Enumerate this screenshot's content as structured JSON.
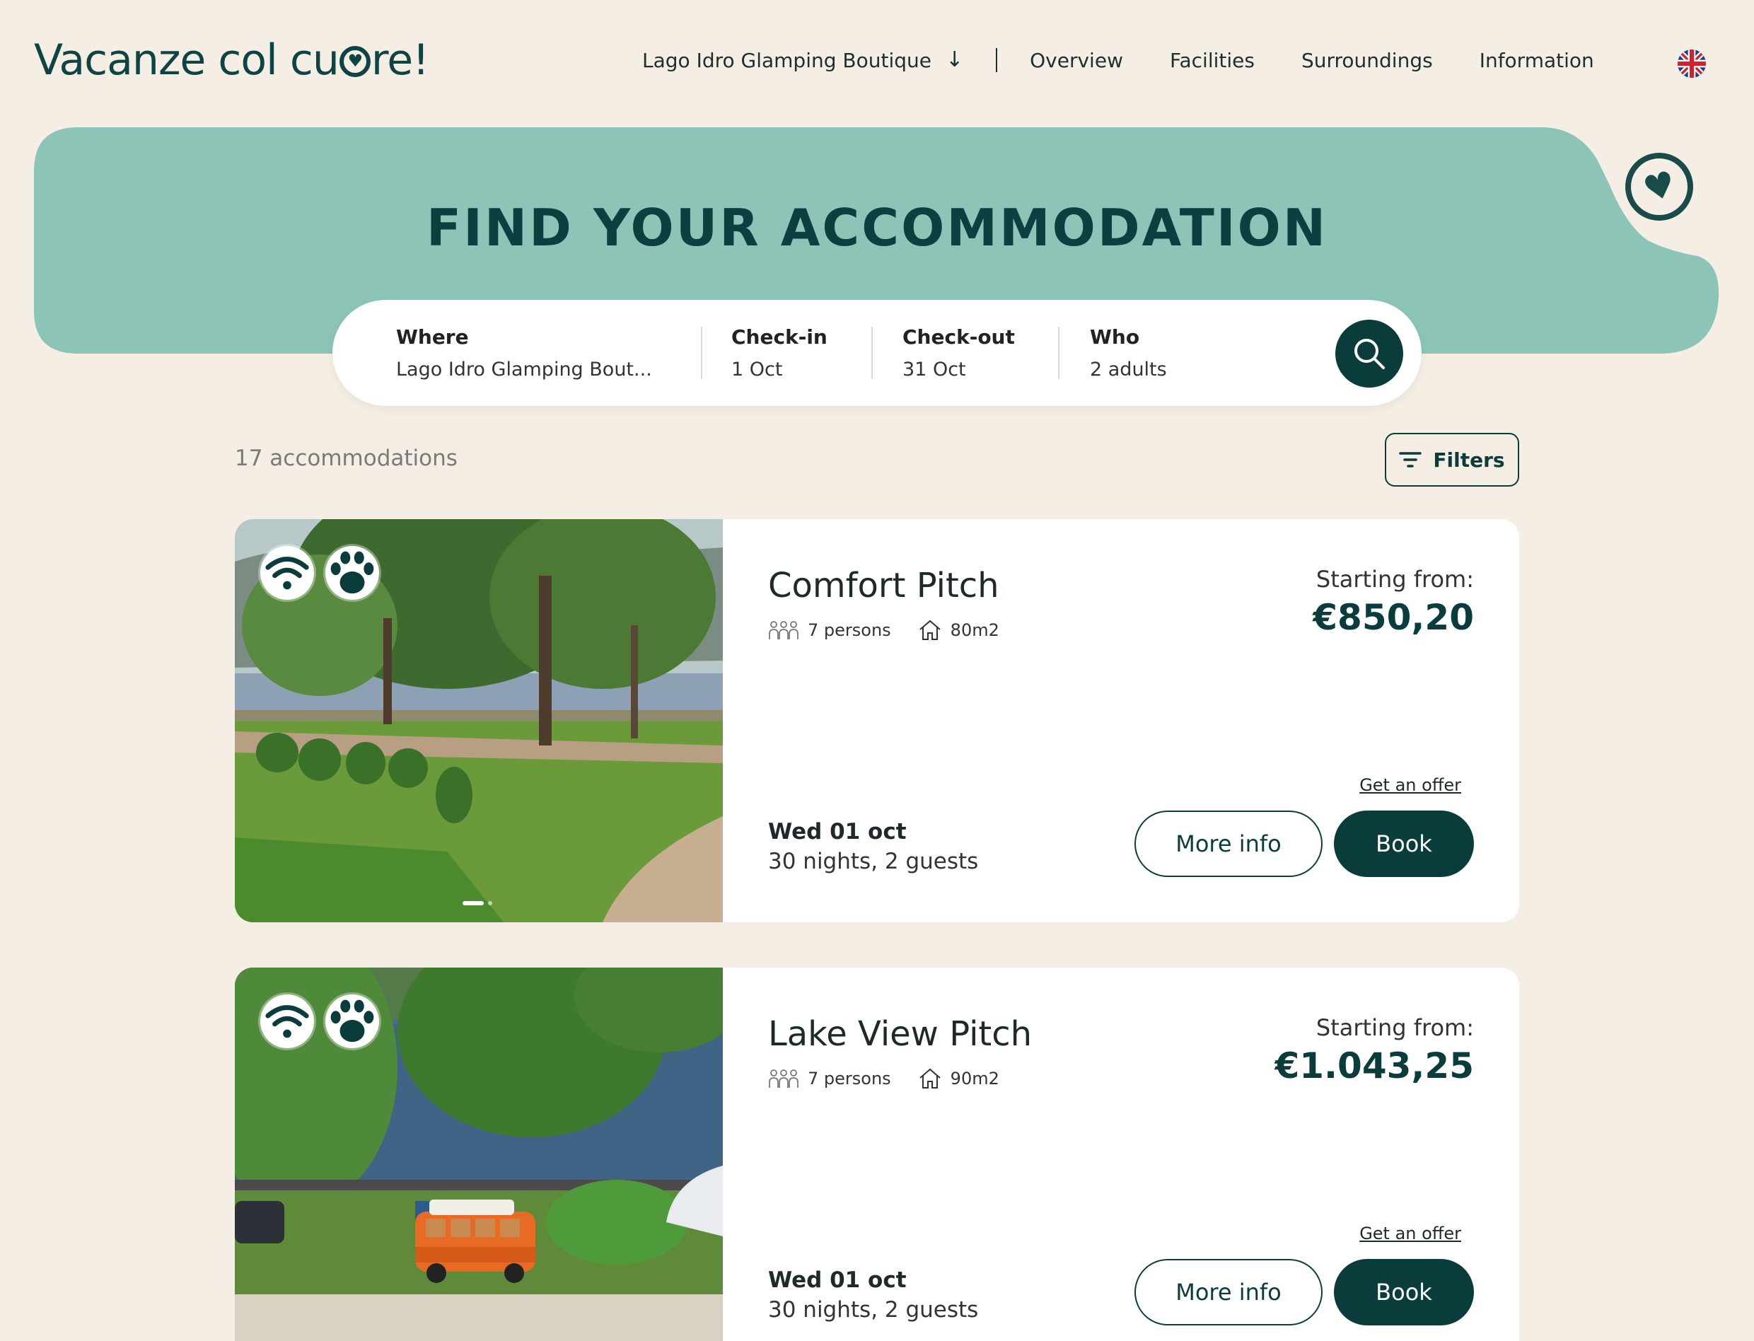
{
  "header": {
    "logo_text_before": "Vacanze col cu",
    "logo_text_after": "re!",
    "property_selector": "Lago Idro Glamping Boutique",
    "nav": [
      "Overview",
      "Facilities",
      "Surroundings",
      "Information"
    ],
    "language_icon": "uk-flag-icon"
  },
  "hero": {
    "title": "FIND YOUR ACCOMMODATION",
    "accent_color": "#8cc5b8",
    "favorite_icon": "heart-icon"
  },
  "search": {
    "where_label": "Where",
    "where_value": "Lago Idro Glamping Bout...",
    "checkin_label": "Check-in",
    "checkin_value": "1 Oct",
    "checkout_label": "Check-out",
    "checkout_value": "31 Oct",
    "who_label": "Who",
    "who_value": "2 adults",
    "button_icon": "search-icon"
  },
  "results": {
    "count_text": "17 accommodations",
    "filters_label": "Filters"
  },
  "accommodations": [
    {
      "title": "Comfort Pitch",
      "persons": "7 persons",
      "area": "80m2",
      "price_label": "Starting from:",
      "price": "€850,20",
      "offer_link": "Get an offer",
      "date": "Wed 01 oct",
      "stay": "30 nights, 2 guests",
      "more_info_label": "More info",
      "book_label": "Book",
      "amenities": [
        "wifi-icon",
        "paw-icon"
      ]
    },
    {
      "title": "Lake View Pitch",
      "persons": "7 persons",
      "area": "90m2",
      "price_label": "Starting from:",
      "price": "€1.043,25",
      "offer_link": "Get an offer",
      "date": "Wed 01 oct",
      "stay": "30 nights, 2 guests",
      "more_info_label": "More info",
      "book_label": "Book",
      "amenities": [
        "wifi-icon",
        "paw-icon"
      ]
    }
  ],
  "colors": {
    "background": "#f5eee4",
    "primary_dark": "#0a3c3c",
    "hero_teal": "#8cc5b8"
  }
}
